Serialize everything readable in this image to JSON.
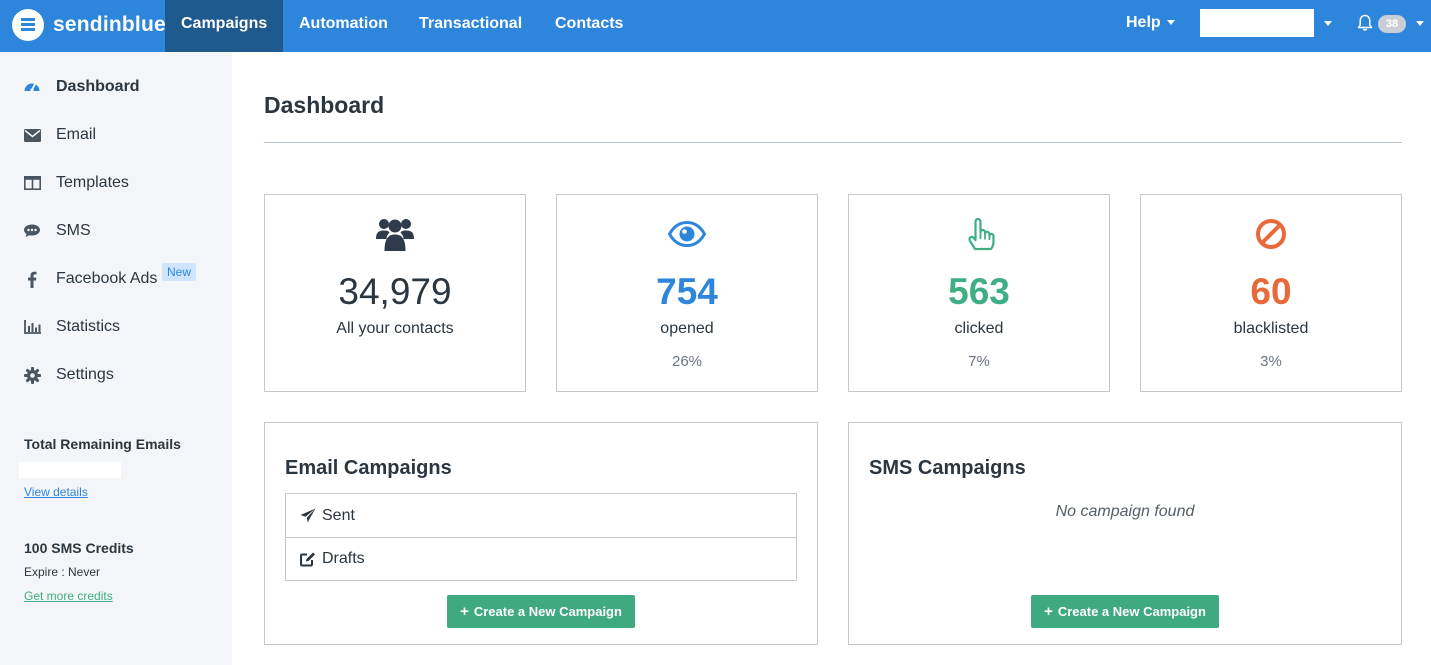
{
  "colors": {
    "brand": "#2d86dc",
    "nav_active": "#1f5a8f",
    "opened": "#2d86dc",
    "clicked": "#3fae82",
    "blacklisted": "#e8693a",
    "button": "#3fa97f"
  },
  "header": {
    "logo_text": "sendinblue",
    "nav": [
      {
        "label": "Campaigns",
        "active": true
      },
      {
        "label": "Automation",
        "active": false
      },
      {
        "label": "Transactional",
        "active": false
      },
      {
        "label": "Contacts",
        "active": false
      }
    ],
    "help_label": "Help",
    "notification_count": "38",
    "icons": {
      "bell": "bell-icon",
      "logo": "logo-icon"
    }
  },
  "sidebar": {
    "items": [
      {
        "label": "Dashboard",
        "icon": "dashboard-icon",
        "active": true
      },
      {
        "label": "Email",
        "icon": "envelope-icon",
        "active": false
      },
      {
        "label": "Templates",
        "icon": "templates-icon",
        "active": false
      },
      {
        "label": "SMS",
        "icon": "sms-icon",
        "active": false
      },
      {
        "label": "Facebook Ads",
        "icon": "facebook-icon",
        "active": false,
        "badge": "New"
      },
      {
        "label": "Statistics",
        "icon": "statistics-icon",
        "active": false
      },
      {
        "label": "Settings",
        "icon": "gear-icon",
        "active": false
      }
    ],
    "remaining_emails_heading": "Total Remaining Emails",
    "view_details_link": "View details",
    "sms_credits_heading": "100 SMS Credits",
    "sms_expire_text": "Expire : Never",
    "get_credits_link": "Get more credits"
  },
  "main": {
    "title": "Dashboard",
    "stats": [
      {
        "value": "34,979",
        "label": "All your contacts",
        "percent": "",
        "icon": "users-icon"
      },
      {
        "value": "754",
        "label": "opened",
        "percent": "26%",
        "icon": "eye-icon"
      },
      {
        "value": "563",
        "label": "clicked",
        "percent": "7%",
        "icon": "pointer-hand-icon"
      },
      {
        "value": "60",
        "label": "blacklisted",
        "percent": "3%",
        "icon": "ban-icon"
      }
    ],
    "email_campaigns": {
      "title": "Email Campaigns",
      "rows": [
        {
          "label": "Sent",
          "icon": "paper-plane-icon"
        },
        {
          "label": "Drafts",
          "icon": "edit-icon"
        }
      ],
      "button_label": "Create a New Campaign"
    },
    "sms_campaigns": {
      "title": "SMS Campaigns",
      "empty_text": "No campaign found",
      "button_label": "Create a New Campaign"
    }
  }
}
